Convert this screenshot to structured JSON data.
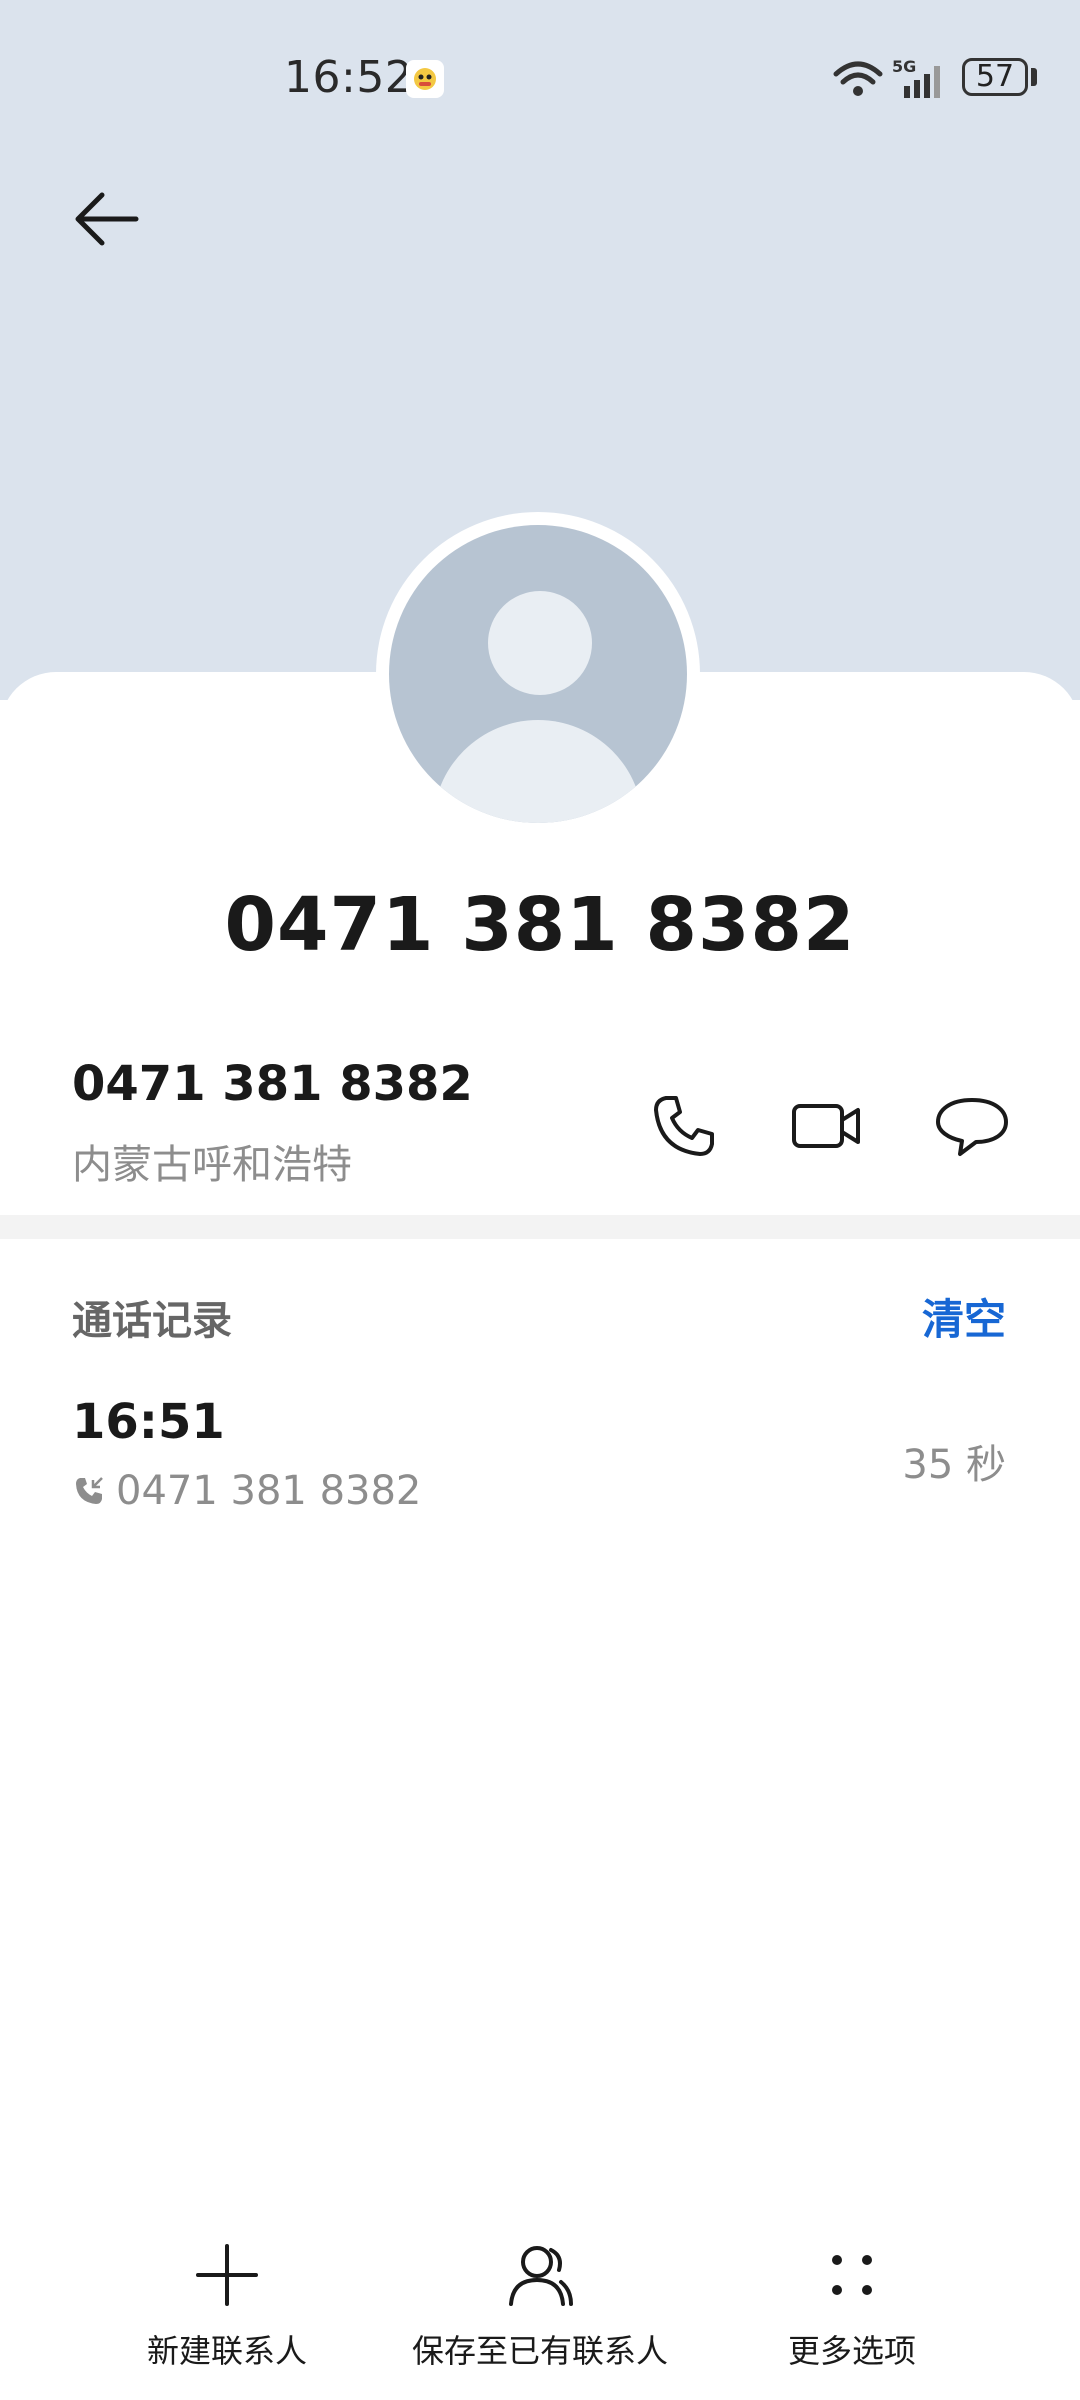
{
  "status_bar": {
    "time": "16:52",
    "network": "5G",
    "battery": "57"
  },
  "header": {
    "back_icon": "back-arrow-icon"
  },
  "contact": {
    "title": "0471 381 8382",
    "number": "0471 381 8382",
    "location": "内蒙古呼和浩特",
    "actions": [
      "phone-icon",
      "video-call-icon",
      "message-icon"
    ]
  },
  "call_log": {
    "title": "通话记录",
    "clear_label": "清空",
    "items": [
      {
        "time": "16:51",
        "number": "0471 381 8382",
        "duration": "35 秒",
        "type_icon": "incoming-call-icon"
      }
    ]
  },
  "bottom_bar": {
    "new_contact": "新建联系人",
    "save_existing": "保存至已有联系人",
    "more_options": "更多选项"
  },
  "colors": {
    "header_bg": "#dbe3ed",
    "accent": "#1767d4",
    "avatar_bg": "#b7c4d2"
  }
}
